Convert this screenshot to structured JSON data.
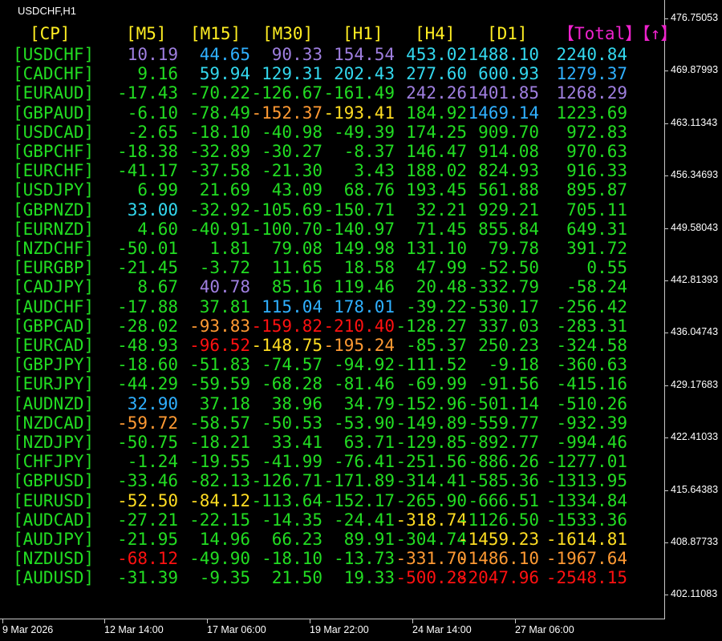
{
  "window": {
    "title": "USDCHF,H1"
  },
  "colors": {
    "green": "#22dd22",
    "yellow": "#ffee22",
    "gold": "#ffdd22",
    "purple": "#9f7fe0",
    "blue": "#2fb0ff",
    "cyan": "#33d8ee",
    "orange": "#ff9a33",
    "red": "#ff1111",
    "pink": "#ee22cc",
    "white": "#ffffff",
    "axis": "#c8c8c8"
  },
  "table": {
    "headers": [
      {
        "label": "[CP]",
        "color": "yellow"
      },
      {
        "label": "[M5]",
        "color": "yellow"
      },
      {
        "label": "[M15]",
        "color": "yellow"
      },
      {
        "label": "[M30]",
        "color": "yellow"
      },
      {
        "label": "[H1]",
        "color": "yellow"
      },
      {
        "label": "[H4]",
        "color": "yellow"
      },
      {
        "label": "[D1]",
        "color": "yellow"
      },
      {
        "label": "【Total】【↑】",
        "color": "pink"
      }
    ],
    "rows": [
      {
        "pair": "[USDCHF]",
        "cells": [
          {
            "v": "10.19",
            "c": "purple"
          },
          {
            "v": "44.65",
            "c": "blue"
          },
          {
            "v": "90.33",
            "c": "purple"
          },
          {
            "v": "154.54",
            "c": "purple"
          },
          {
            "v": "453.02",
            "c": "cyan"
          },
          {
            "v": "1488.10",
            "c": "cyan"
          },
          {
            "v": "2240.84",
            "c": "cyan"
          }
        ]
      },
      {
        "pair": "[CADCHF]",
        "cells": [
          {
            "v": "9.16",
            "c": "green"
          },
          {
            "v": "59.94",
            "c": "cyan"
          },
          {
            "v": "129.31",
            "c": "cyan"
          },
          {
            "v": "202.43",
            "c": "cyan"
          },
          {
            "v": "277.60",
            "c": "cyan"
          },
          {
            "v": "600.93",
            "c": "cyan"
          },
          {
            "v": "1279.37",
            "c": "blue"
          }
        ]
      },
      {
        "pair": "[EURAUD]",
        "cells": [
          {
            "v": "-17.43",
            "c": "green"
          },
          {
            "v": "-70.22",
            "c": "green"
          },
          {
            "v": "-126.67",
            "c": "green"
          },
          {
            "v": "-161.49",
            "c": "green"
          },
          {
            "v": "242.26",
            "c": "purple"
          },
          {
            "v": "1401.85",
            "c": "purple"
          },
          {
            "v": "1268.29",
            "c": "purple"
          }
        ]
      },
      {
        "pair": "[GBPAUD]",
        "cells": [
          {
            "v": "-6.10",
            "c": "green"
          },
          {
            "v": "-78.49",
            "c": "green"
          },
          {
            "v": "-152.37",
            "c": "orange"
          },
          {
            "v": "-193.41",
            "c": "gold"
          },
          {
            "v": "184.92",
            "c": "green"
          },
          {
            "v": "1469.14",
            "c": "blue"
          },
          {
            "v": "1223.69",
            "c": "green"
          }
        ]
      },
      {
        "pair": "[USDCAD]",
        "cells": [
          {
            "v": "-2.65",
            "c": "green"
          },
          {
            "v": "-18.10",
            "c": "green"
          },
          {
            "v": "-40.98",
            "c": "green"
          },
          {
            "v": "-49.39",
            "c": "green"
          },
          {
            "v": "174.25",
            "c": "green"
          },
          {
            "v": "909.70",
            "c": "green"
          },
          {
            "v": "972.83",
            "c": "green"
          }
        ]
      },
      {
        "pair": "[GBPCHF]",
        "cells": [
          {
            "v": "-18.38",
            "c": "green"
          },
          {
            "v": "-32.89",
            "c": "green"
          },
          {
            "v": "-30.27",
            "c": "green"
          },
          {
            "v": "-8.37",
            "c": "green"
          },
          {
            "v": "146.47",
            "c": "green"
          },
          {
            "v": "914.08",
            "c": "green"
          },
          {
            "v": "970.63",
            "c": "green"
          }
        ]
      },
      {
        "pair": "[EURCHF]",
        "cells": [
          {
            "v": "-41.17",
            "c": "green"
          },
          {
            "v": "-37.58",
            "c": "green"
          },
          {
            "v": "-21.30",
            "c": "green"
          },
          {
            "v": "3.43",
            "c": "green"
          },
          {
            "v": "188.02",
            "c": "green"
          },
          {
            "v": "824.93",
            "c": "green"
          },
          {
            "v": "916.33",
            "c": "green"
          }
        ]
      },
      {
        "pair": "[USDJPY]",
        "cells": [
          {
            "v": "6.99",
            "c": "green"
          },
          {
            "v": "21.69",
            "c": "green"
          },
          {
            "v": "43.09",
            "c": "green"
          },
          {
            "v": "68.76",
            "c": "green"
          },
          {
            "v": "193.45",
            "c": "green"
          },
          {
            "v": "561.88",
            "c": "green"
          },
          {
            "v": "895.87",
            "c": "green"
          }
        ]
      },
      {
        "pair": "[GBPNZD]",
        "cells": [
          {
            "v": "33.00",
            "c": "cyan"
          },
          {
            "v": "-32.92",
            "c": "green"
          },
          {
            "v": "-105.69",
            "c": "green"
          },
          {
            "v": "-150.71",
            "c": "green"
          },
          {
            "v": "32.21",
            "c": "green"
          },
          {
            "v": "929.21",
            "c": "green"
          },
          {
            "v": "705.11",
            "c": "green"
          }
        ]
      },
      {
        "pair": "[EURNZD]",
        "cells": [
          {
            "v": "4.60",
            "c": "green"
          },
          {
            "v": "-40.91",
            "c": "green"
          },
          {
            "v": "-100.70",
            "c": "green"
          },
          {
            "v": "-140.97",
            "c": "green"
          },
          {
            "v": "71.45",
            "c": "green"
          },
          {
            "v": "855.84",
            "c": "green"
          },
          {
            "v": "649.31",
            "c": "green"
          }
        ]
      },
      {
        "pair": "[NZDCHF]",
        "cells": [
          {
            "v": "-50.01",
            "c": "green"
          },
          {
            "v": "1.81",
            "c": "green"
          },
          {
            "v": "79.08",
            "c": "green"
          },
          {
            "v": "149.98",
            "c": "green"
          },
          {
            "v": "131.10",
            "c": "green"
          },
          {
            "v": "79.78",
            "c": "green"
          },
          {
            "v": "391.72",
            "c": "green"
          }
        ]
      },
      {
        "pair": "[EURGBP]",
        "cells": [
          {
            "v": "-21.45",
            "c": "green"
          },
          {
            "v": "-3.72",
            "c": "green"
          },
          {
            "v": "11.65",
            "c": "green"
          },
          {
            "v": "18.58",
            "c": "green"
          },
          {
            "v": "47.99",
            "c": "green"
          },
          {
            "v": "-52.50",
            "c": "green"
          },
          {
            "v": "0.55",
            "c": "green"
          }
        ]
      },
      {
        "pair": "[CADJPY]",
        "cells": [
          {
            "v": "8.67",
            "c": "green"
          },
          {
            "v": "40.78",
            "c": "purple"
          },
          {
            "v": "85.16",
            "c": "green"
          },
          {
            "v": "119.46",
            "c": "green"
          },
          {
            "v": "20.48",
            "c": "green"
          },
          {
            "v": "-332.79",
            "c": "green"
          },
          {
            "v": "-58.24",
            "c": "green"
          }
        ]
      },
      {
        "pair": "[AUDCHF]",
        "cells": [
          {
            "v": "-17.88",
            "c": "green"
          },
          {
            "v": "37.81",
            "c": "green"
          },
          {
            "v": "115.04",
            "c": "blue"
          },
          {
            "v": "178.01",
            "c": "blue"
          },
          {
            "v": "-39.22",
            "c": "green"
          },
          {
            "v": "-530.17",
            "c": "green"
          },
          {
            "v": "-256.42",
            "c": "green"
          }
        ]
      },
      {
        "pair": "[GBPCAD]",
        "cells": [
          {
            "v": "-28.02",
            "c": "green"
          },
          {
            "v": "-93.83",
            "c": "orange"
          },
          {
            "v": "-159.82",
            "c": "red"
          },
          {
            "v": "-210.40",
            "c": "red"
          },
          {
            "v": "-128.27",
            "c": "green"
          },
          {
            "v": "337.03",
            "c": "green"
          },
          {
            "v": "-283.31",
            "c": "green"
          }
        ]
      },
      {
        "pair": "[EURCAD]",
        "cells": [
          {
            "v": "-48.93",
            "c": "green"
          },
          {
            "v": "-96.52",
            "c": "red"
          },
          {
            "v": "-148.75",
            "c": "gold"
          },
          {
            "v": "-195.24",
            "c": "orange"
          },
          {
            "v": "-85.37",
            "c": "green"
          },
          {
            "v": "250.23",
            "c": "green"
          },
          {
            "v": "-324.58",
            "c": "green"
          }
        ]
      },
      {
        "pair": "[GBPJPY]",
        "cells": [
          {
            "v": "-18.60",
            "c": "green"
          },
          {
            "v": "-51.83",
            "c": "green"
          },
          {
            "v": "-74.57",
            "c": "green"
          },
          {
            "v": "-94.92",
            "c": "green"
          },
          {
            "v": "-111.52",
            "c": "green"
          },
          {
            "v": "-9.18",
            "c": "green"
          },
          {
            "v": "-360.63",
            "c": "green"
          }
        ]
      },
      {
        "pair": "[EURJPY]",
        "cells": [
          {
            "v": "-44.29",
            "c": "green"
          },
          {
            "v": "-59.59",
            "c": "green"
          },
          {
            "v": "-68.28",
            "c": "green"
          },
          {
            "v": "-81.46",
            "c": "green"
          },
          {
            "v": "-69.99",
            "c": "green"
          },
          {
            "v": "-91.56",
            "c": "green"
          },
          {
            "v": "-415.16",
            "c": "green"
          }
        ]
      },
      {
        "pair": "[AUDNZD]",
        "cells": [
          {
            "v": "32.90",
            "c": "blue"
          },
          {
            "v": "37.18",
            "c": "green"
          },
          {
            "v": "38.96",
            "c": "green"
          },
          {
            "v": "34.79",
            "c": "green"
          },
          {
            "v": "-152.96",
            "c": "green"
          },
          {
            "v": "-501.14",
            "c": "green"
          },
          {
            "v": "-510.26",
            "c": "green"
          }
        ]
      },
      {
        "pair": "[NZDCAD]",
        "cells": [
          {
            "v": "-59.72",
            "c": "orange"
          },
          {
            "v": "-58.57",
            "c": "green"
          },
          {
            "v": "-50.53",
            "c": "green"
          },
          {
            "v": "-53.90",
            "c": "green"
          },
          {
            "v": "-149.89",
            "c": "green"
          },
          {
            "v": "-559.77",
            "c": "green"
          },
          {
            "v": "-932.39",
            "c": "green"
          }
        ]
      },
      {
        "pair": "[NZDJPY]",
        "cells": [
          {
            "v": "-50.75",
            "c": "green"
          },
          {
            "v": "-18.21",
            "c": "green"
          },
          {
            "v": "33.41",
            "c": "green"
          },
          {
            "v": "63.71",
            "c": "green"
          },
          {
            "v": "-129.85",
            "c": "green"
          },
          {
            "v": "-892.77",
            "c": "green"
          },
          {
            "v": "-994.46",
            "c": "green"
          }
        ]
      },
      {
        "pair": "[CHFJPY]",
        "cells": [
          {
            "v": "-1.24",
            "c": "green"
          },
          {
            "v": "-19.55",
            "c": "green"
          },
          {
            "v": "-41.99",
            "c": "green"
          },
          {
            "v": "-76.41",
            "c": "green"
          },
          {
            "v": "-251.56",
            "c": "green"
          },
          {
            "v": "-886.26",
            "c": "green"
          },
          {
            "v": "-1277.01",
            "c": "green"
          }
        ]
      },
      {
        "pair": "[GBPUSD]",
        "cells": [
          {
            "v": "-33.46",
            "c": "green"
          },
          {
            "v": "-82.13",
            "c": "green"
          },
          {
            "v": "-126.71",
            "c": "green"
          },
          {
            "v": "-171.89",
            "c": "green"
          },
          {
            "v": "-314.41",
            "c": "green"
          },
          {
            "v": "-585.36",
            "c": "green"
          },
          {
            "v": "-1313.95",
            "c": "green"
          }
        ]
      },
      {
        "pair": "[EURUSD]",
        "cells": [
          {
            "v": "-52.50",
            "c": "gold"
          },
          {
            "v": "-84.12",
            "c": "gold"
          },
          {
            "v": "-113.64",
            "c": "green"
          },
          {
            "v": "-152.17",
            "c": "green"
          },
          {
            "v": "-265.90",
            "c": "green"
          },
          {
            "v": "-666.51",
            "c": "green"
          },
          {
            "v": "-1334.84",
            "c": "green"
          }
        ]
      },
      {
        "pair": "[AUDCAD]",
        "cells": [
          {
            "v": "-27.21",
            "c": "green"
          },
          {
            "v": "-22.15",
            "c": "green"
          },
          {
            "v": "-14.35",
            "c": "green"
          },
          {
            "v": "-24.41",
            "c": "green"
          },
          {
            "v": "-318.74",
            "c": "gold"
          },
          {
            "v": "-1126.50",
            "c": "green"
          },
          {
            "v": "-1533.36",
            "c": "green"
          }
        ]
      },
      {
        "pair": "[AUDJPY]",
        "cells": [
          {
            "v": "-21.95",
            "c": "green"
          },
          {
            "v": "14.96",
            "c": "green"
          },
          {
            "v": "66.23",
            "c": "green"
          },
          {
            "v": "89.91",
            "c": "green"
          },
          {
            "v": "-304.74",
            "c": "green"
          },
          {
            "v": "-1459.23",
            "c": "gold"
          },
          {
            "v": "-1614.81",
            "c": "gold"
          }
        ]
      },
      {
        "pair": "[NZDUSD]",
        "cells": [
          {
            "v": "-68.12",
            "c": "red"
          },
          {
            "v": "-49.90",
            "c": "green"
          },
          {
            "v": "-18.10",
            "c": "green"
          },
          {
            "v": "-13.73",
            "c": "green"
          },
          {
            "v": "-331.70",
            "c": "orange"
          },
          {
            "v": "-1486.10",
            "c": "orange"
          },
          {
            "v": "-1967.64",
            "c": "orange"
          }
        ]
      },
      {
        "pair": "[AUDUSD]",
        "cells": [
          {
            "v": "-31.39",
            "c": "green"
          },
          {
            "v": "-9.35",
            "c": "green"
          },
          {
            "v": "21.50",
            "c": "green"
          },
          {
            "v": "19.33",
            "c": "green"
          },
          {
            "v": "-500.28",
            "c": "red"
          },
          {
            "v": "-2047.96",
            "c": "red"
          },
          {
            "v": "-2548.15",
            "c": "red"
          }
        ]
      }
    ]
  },
  "price_axis": [
    "476.75053",
    "469.87993",
    "463.11343",
    "456.34693",
    "449.58043",
    "442.81393",
    "436.04743",
    "429.17683",
    "422.41033",
    "415.64383",
    "408.87733",
    "402.11083"
  ],
  "time_axis": [
    "9 Mar 2026",
    "12 Mar 14:00",
    "17 Mar 06:00",
    "19 Mar 22:00",
    "24 Mar 14:00",
    "27 Mar 06:00"
  ]
}
